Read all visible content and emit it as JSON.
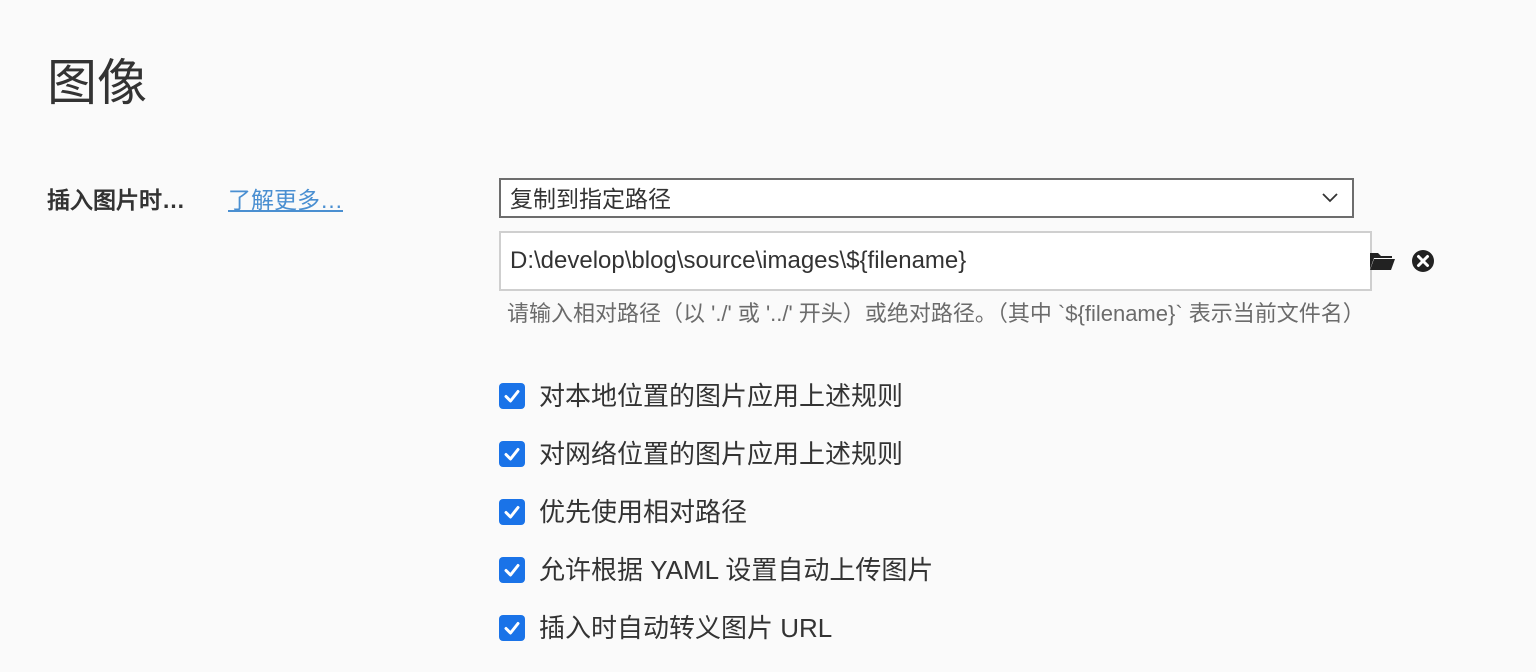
{
  "section": {
    "title": "图像"
  },
  "insert_image": {
    "label": "插入图片时…",
    "learn_more": "了解更多…",
    "select_value": "复制到指定路径",
    "path_value": "D:\\develop\\blog\\source\\images\\${filename}",
    "hint": "请输入相对路径（以 './' 或 '../' 开头）或绝对路径。（其中 `${filename}` 表示当前文件名）",
    "folder_icon": "folder-icon",
    "clear_icon": "clear-circle-icon"
  },
  "options": [
    {
      "label": "对本地位置的图片应用上述规则",
      "checked": true
    },
    {
      "label": "对网络位置的图片应用上述规则",
      "checked": true
    },
    {
      "label": "优先使用相对路径",
      "checked": true
    },
    {
      "label": "允许根据 YAML 设置自动上传图片",
      "checked": true
    },
    {
      "label": "插入时自动转义图片 URL",
      "checked": true
    }
  ],
  "colors": {
    "accent": "#1a73e8",
    "link": "#4a8fd1",
    "background": "#fafafa"
  }
}
